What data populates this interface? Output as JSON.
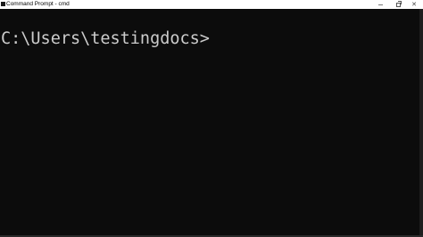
{
  "window": {
    "title": "Command Prompt - cmd",
    "icon": "cmd-app-icon",
    "controls": {
      "minimize_icon": "minimize-icon",
      "maximize_icon": "maximize-icon",
      "close_icon": "close-icon",
      "close_glyph": "✕"
    }
  },
  "console": {
    "prompt": "C:\\Users\\testingdocs>",
    "background": "#0c0c0c",
    "foreground": "#cccccc"
  }
}
